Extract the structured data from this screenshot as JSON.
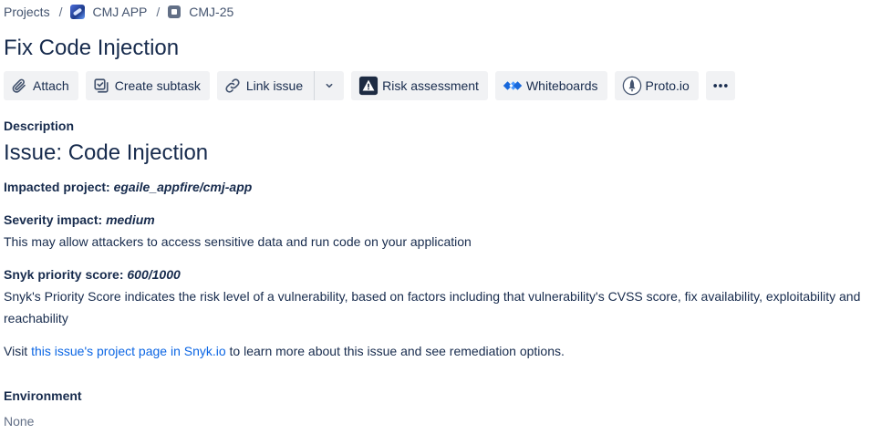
{
  "breadcrumb": {
    "root": "Projects",
    "separator": "/",
    "project": "CMJ APP",
    "issue_key": "CMJ-25"
  },
  "issue": {
    "title": "Fix Code Injection"
  },
  "toolbar": {
    "attach": "Attach",
    "create_subtask": "Create subtask",
    "link_issue": "Link issue",
    "risk_assessment": "Risk assessment",
    "whiteboards": "Whiteboards",
    "proto": "Proto.io"
  },
  "description": {
    "label": "Description",
    "heading": "Issue: Code Injection",
    "impacted_label": "Impacted project:",
    "impacted_value": "egaile_appfire/cmj-app",
    "severity_label": "Severity impact:",
    "severity_value": "medium",
    "severity_text": "This may allow attackers to access sensitive data and run code on your application",
    "score_label": "Snyk priority score:",
    "score_value": "600/1000",
    "score_text": "Snyk's Priority Score indicates the risk level of a vulnerability, based on factors including that vulnerability's CVSS score, fix availability, exploitability and reachability",
    "visit_prefix": "Visit",
    "visit_link": "this issue's project page in Snyk.io",
    "visit_suffix": "to learn more about this issue and see remediation options."
  },
  "environment": {
    "label": "Environment",
    "value": "None"
  },
  "colors": {
    "link": "#0c66e4",
    "button_bg": "#f1f2f4",
    "text": "#172b4d"
  }
}
